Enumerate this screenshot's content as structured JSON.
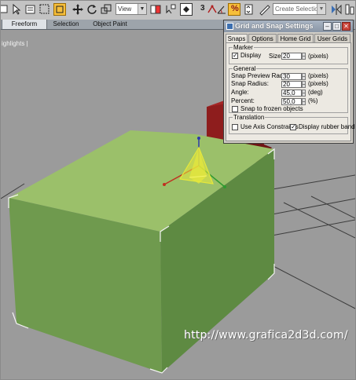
{
  "toolbar": {
    "view_select": "View",
    "selection_set_placeholder": "Create Selection Se",
    "snap_label": "3",
    "snap_angle_label": "",
    "snap_pct_label": "%",
    "snap_spinner_label": "≤"
  },
  "ribbon": {
    "tabs": [
      "Freeform",
      "Selection",
      "Object Paint"
    ]
  },
  "viewport": {
    "label": "ighlights |"
  },
  "watermark": "http://www.grafica2d3d.com/",
  "dialog": {
    "title": "Grid and Snap Settings",
    "tabs": [
      "Snaps",
      "Options",
      "Home Grid",
      "User Grids"
    ],
    "marker": {
      "title": "Marker",
      "display_label": "Display",
      "display_checked": "✓",
      "size_label": "Size:",
      "size_value": "20",
      "size_unit": "(pixels)"
    },
    "general": {
      "title": "General",
      "preview_radius_label": "Snap Preview Radius:",
      "preview_radius_value": "30",
      "preview_radius_unit": "(pixels)",
      "snap_radius_label": "Snap Radius:",
      "snap_radius_value": "20",
      "snap_radius_unit": "(pixels)",
      "angle_label": "Angle:",
      "angle_value": "45,0",
      "angle_unit": "(deg)",
      "percent_label": "Percent:",
      "percent_value": "50,0",
      "percent_unit": "(%)",
      "frozen_label": "Snap to frozen objects",
      "frozen_checked": ""
    },
    "translation": {
      "title": "Translation",
      "axis_label": "Use Axis Constraints",
      "axis_checked": "",
      "rubber_label": "Display rubber band",
      "rubber_checked": "✓"
    }
  },
  "colors": {
    "box_top": "#9bc06a",
    "box_front": "#6f9a4e",
    "box_side": "#5e8a42",
    "red_box": "#8e1d1d",
    "viewport_bg": "#9b9b9b",
    "gizmo": "#e7e83a",
    "snap_active": "#f7bf3a"
  }
}
